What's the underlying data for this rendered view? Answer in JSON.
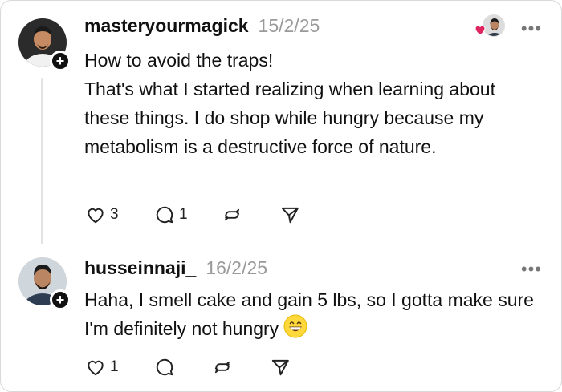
{
  "posts": [
    {
      "username": "masteryourmagick",
      "date": "15/2/25",
      "title": "How to avoid the traps!",
      "body": "That's what I started realizing when learning about these things. I do shop while hungry because my metabolism is a destructive force of nature.",
      "likes": "3",
      "replies": "1",
      "liked_by_author": true
    },
    {
      "username": "husseinnaji_",
      "date": "16/2/25",
      "body": "Haha, I smell cake and gain 5 lbs, so I gotta make sure I'm definitely not hungry",
      "emoji": "grinning-face-emoji",
      "likes": "1",
      "replies": ""
    }
  ],
  "icons": {
    "more": "more-icon",
    "follow": "plus-icon",
    "like": "heart-icon",
    "reply": "comment-icon",
    "repost": "repost-icon",
    "share": "send-icon"
  },
  "colors": {
    "heart_red": "#e0245e",
    "muted": "#9a9a9a",
    "thread_line": "#e2e2e2"
  },
  "more_glyph": "•••",
  "plus_glyph": "+"
}
